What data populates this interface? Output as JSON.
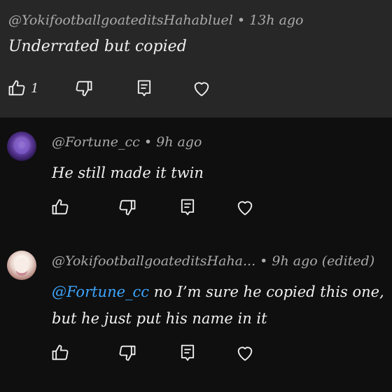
{
  "parent_comment": {
    "author": "@YokifootballgoateditsHahabluel",
    "time": "13h ago",
    "text": "Underrated but copied",
    "like_count": "1"
  },
  "replies": [
    {
      "author": "@Fortune_cc",
      "time": "9h ago",
      "text": "He still made it twin"
    },
    {
      "author": "@YokifootballgoateditsHaha...",
      "time": "9h ago (edited)",
      "mention": "@Fortune_cc",
      "text": " no I’m sure he copied this one, but he just put his name in it"
    }
  ],
  "separator": " • ",
  "icons": {
    "like": "thumbs-up-icon",
    "dislike": "thumbs-down-icon",
    "reply": "reply-comment-icon",
    "heart": "heart-icon",
    "avatar_1": "purple-avatar",
    "avatar_2": "anime-avatar"
  },
  "colors": {
    "mention": "#3ea6ff",
    "highlight_bg": "#272727",
    "bg": "#0f0f0f"
  }
}
